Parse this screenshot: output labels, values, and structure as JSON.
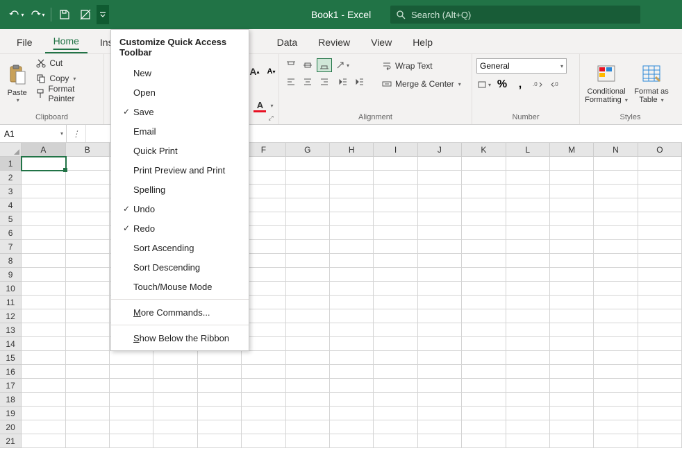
{
  "titlebar": {
    "app_title": "Book1  -  Excel",
    "search_placeholder": "Search (Alt+Q)"
  },
  "tabs": {
    "file": "File",
    "home": "Home",
    "insert": "Ins",
    "data": "Data",
    "review": "Review",
    "view": "View",
    "help": "Help"
  },
  "ribbon": {
    "clipboard": {
      "label": "Clipboard",
      "paste": "Paste",
      "cut": "Cut",
      "copy": "Copy",
      "format_painter": "Format Painter"
    },
    "font": {
      "grow": "A",
      "shrink": "A"
    },
    "alignment": {
      "label": "Alignment",
      "wrap": "Wrap Text",
      "merge": "Merge & Center"
    },
    "number": {
      "label": "Number",
      "format": "General",
      "percent": "%",
      "comma": ","
    },
    "styles": {
      "label": "Styles",
      "conditional1": "Conditional",
      "conditional2": "Formatting",
      "table1": "Format as",
      "table2": "Table"
    }
  },
  "namebox": {
    "value": "A1"
  },
  "qat_menu": {
    "title": "Customize Quick Access Toolbar",
    "items": [
      {
        "label": "New",
        "checked": false
      },
      {
        "label": "Open",
        "checked": false
      },
      {
        "label": "Save",
        "checked": true
      },
      {
        "label": "Email",
        "checked": false
      },
      {
        "label": "Quick Print",
        "checked": false
      },
      {
        "label": "Print Preview and Print",
        "checked": false
      },
      {
        "label": "Spelling",
        "checked": false
      },
      {
        "label": "Undo",
        "checked": true
      },
      {
        "label": "Redo",
        "checked": true
      },
      {
        "label": "Sort Ascending",
        "checked": false
      },
      {
        "label": "Sort Descending",
        "checked": false
      },
      {
        "label": "Touch/Mouse Mode",
        "checked": false
      }
    ],
    "more": "More Commands...",
    "below": "Show Below the Ribbon"
  },
  "columns": [
    "A",
    "B",
    "",
    "",
    "",
    "F",
    "G",
    "H",
    "I",
    "J",
    "K",
    "L",
    "M",
    "N",
    "O"
  ],
  "rows": [
    "1",
    "2",
    "3",
    "4",
    "5",
    "6",
    "7",
    "8",
    "9",
    "10",
    "11",
    "12",
    "13",
    "14",
    "15",
    "16",
    "17",
    "18",
    "19",
    "20",
    "21"
  ]
}
